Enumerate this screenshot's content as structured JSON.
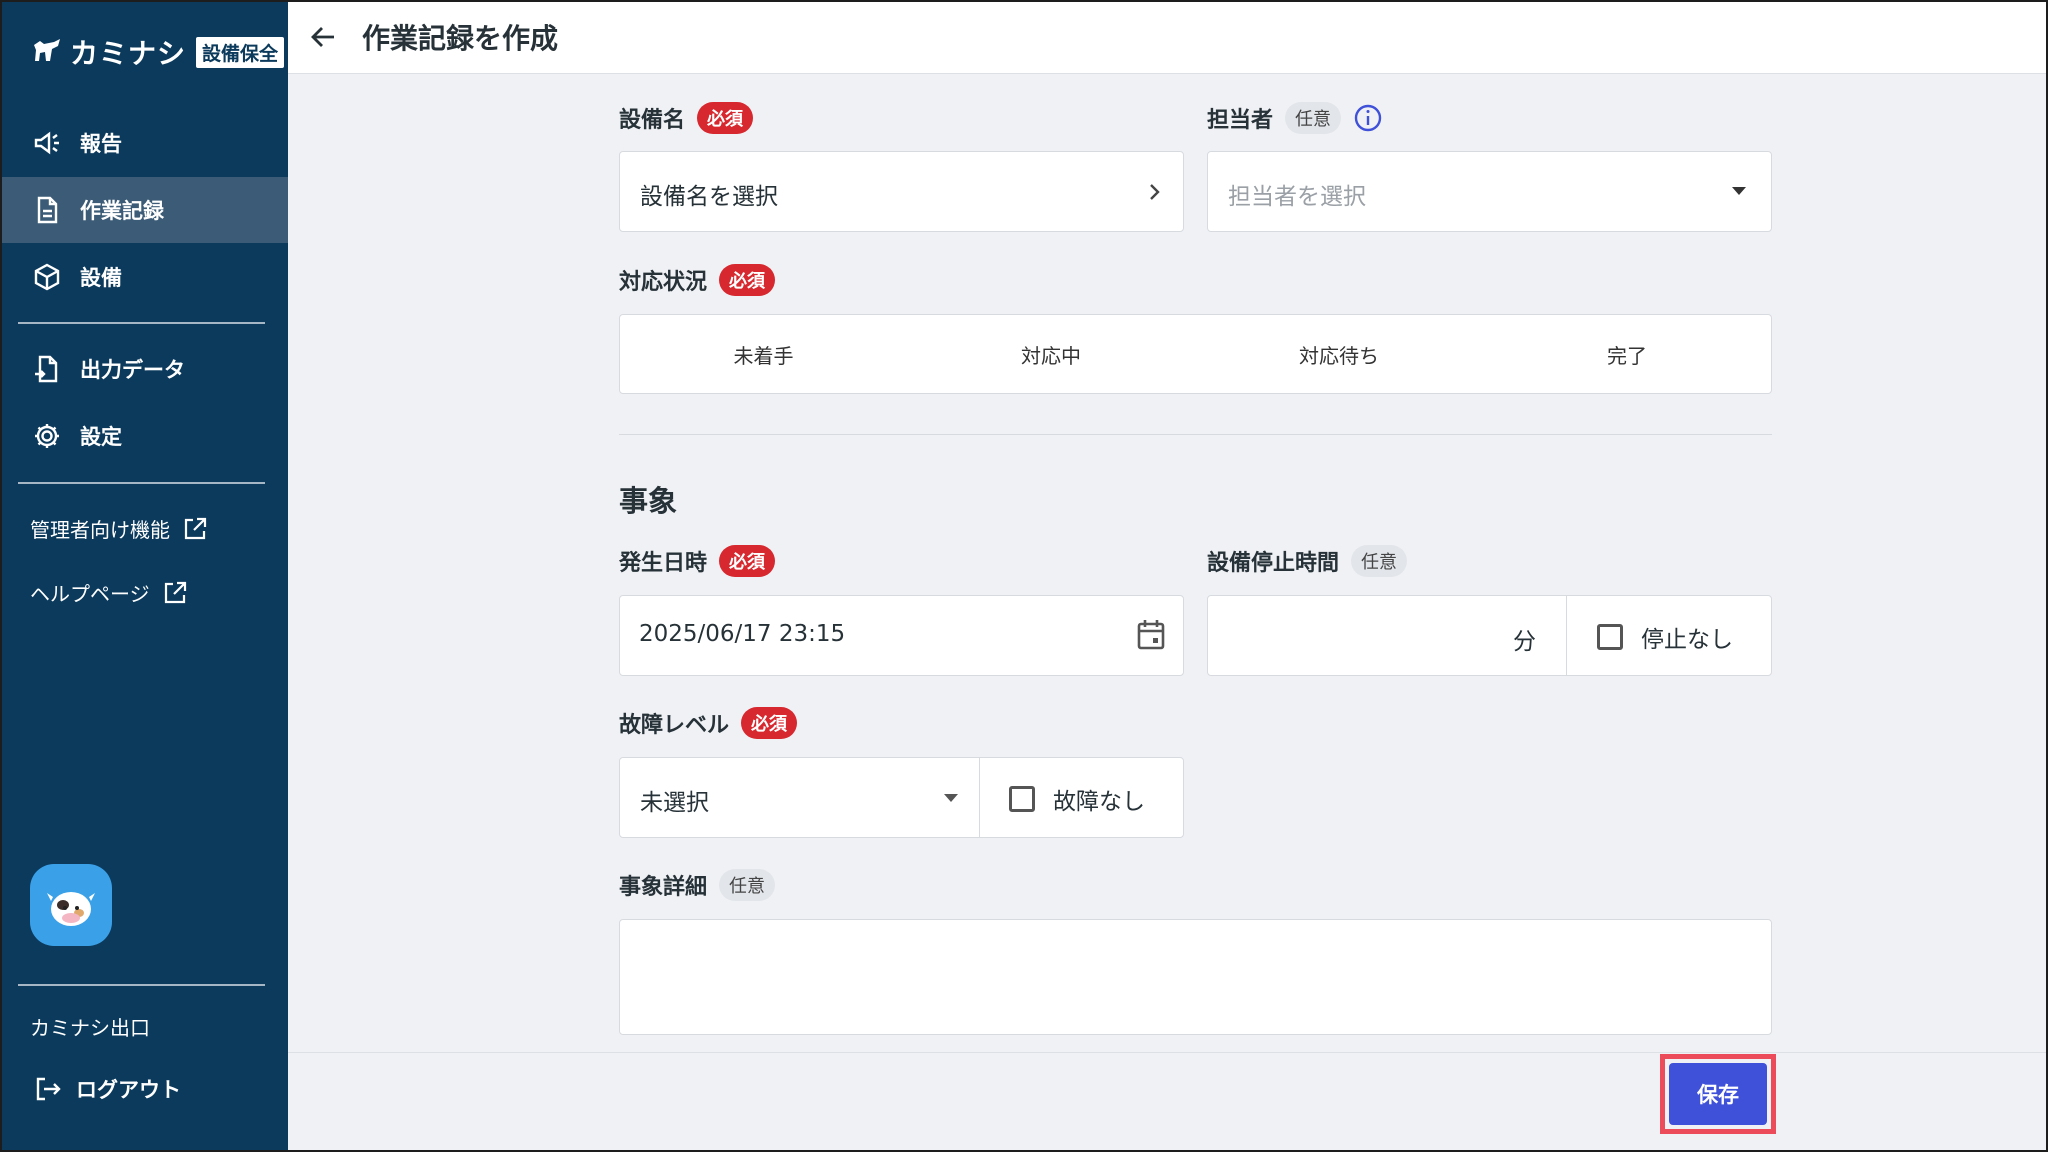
{
  "app": {
    "name": "カミナシ",
    "badge": "設備保全"
  },
  "sidebar": {
    "items": [
      {
        "label": "報告",
        "icon": "megaphone-icon"
      },
      {
        "label": "作業記録",
        "icon": "document-icon",
        "active": true
      },
      {
        "label": "設備",
        "icon": "cube-icon"
      },
      {
        "label": "出力データ",
        "icon": "file-export-icon"
      },
      {
        "label": "設定",
        "icon": "gear-icon"
      }
    ],
    "links": [
      {
        "label": "管理者向け機能",
        "icon": "external-link-icon"
      },
      {
        "label": "ヘルプページ",
        "icon": "external-link-icon"
      }
    ],
    "footer_label": "カミナシ出口",
    "logout_label": "ログアウト"
  },
  "header": {
    "title": "作業記録を作成"
  },
  "form": {
    "equipment": {
      "label": "設備名",
      "badge": "必須",
      "placeholder": "設備名を選択"
    },
    "assignee": {
      "label": "担当者",
      "badge": "任意",
      "placeholder": "担当者を選択"
    },
    "status": {
      "label": "対応状況",
      "badge": "必須",
      "options": [
        "未着手",
        "対応中",
        "対応待ち",
        "完了"
      ]
    },
    "section_title": "事象",
    "occurred_at": {
      "label": "発生日時",
      "badge": "必須",
      "value": "2025/06/17 23:15"
    },
    "downtime": {
      "label": "設備停止時間",
      "badge": "任意",
      "unit": "分",
      "checkbox_label": "停止なし"
    },
    "fault_level": {
      "label": "故障レベル",
      "badge": "必須",
      "value": "未選択",
      "checkbox_label": "故障なし"
    },
    "details": {
      "label": "事象詳細",
      "badge": "任意"
    }
  },
  "actions": {
    "save_label": "保存"
  },
  "colors": {
    "sidebar": "#0b3a5c",
    "required": "#d6282e",
    "primary": "#3f51d8",
    "highlight": "#ec4b5a"
  }
}
